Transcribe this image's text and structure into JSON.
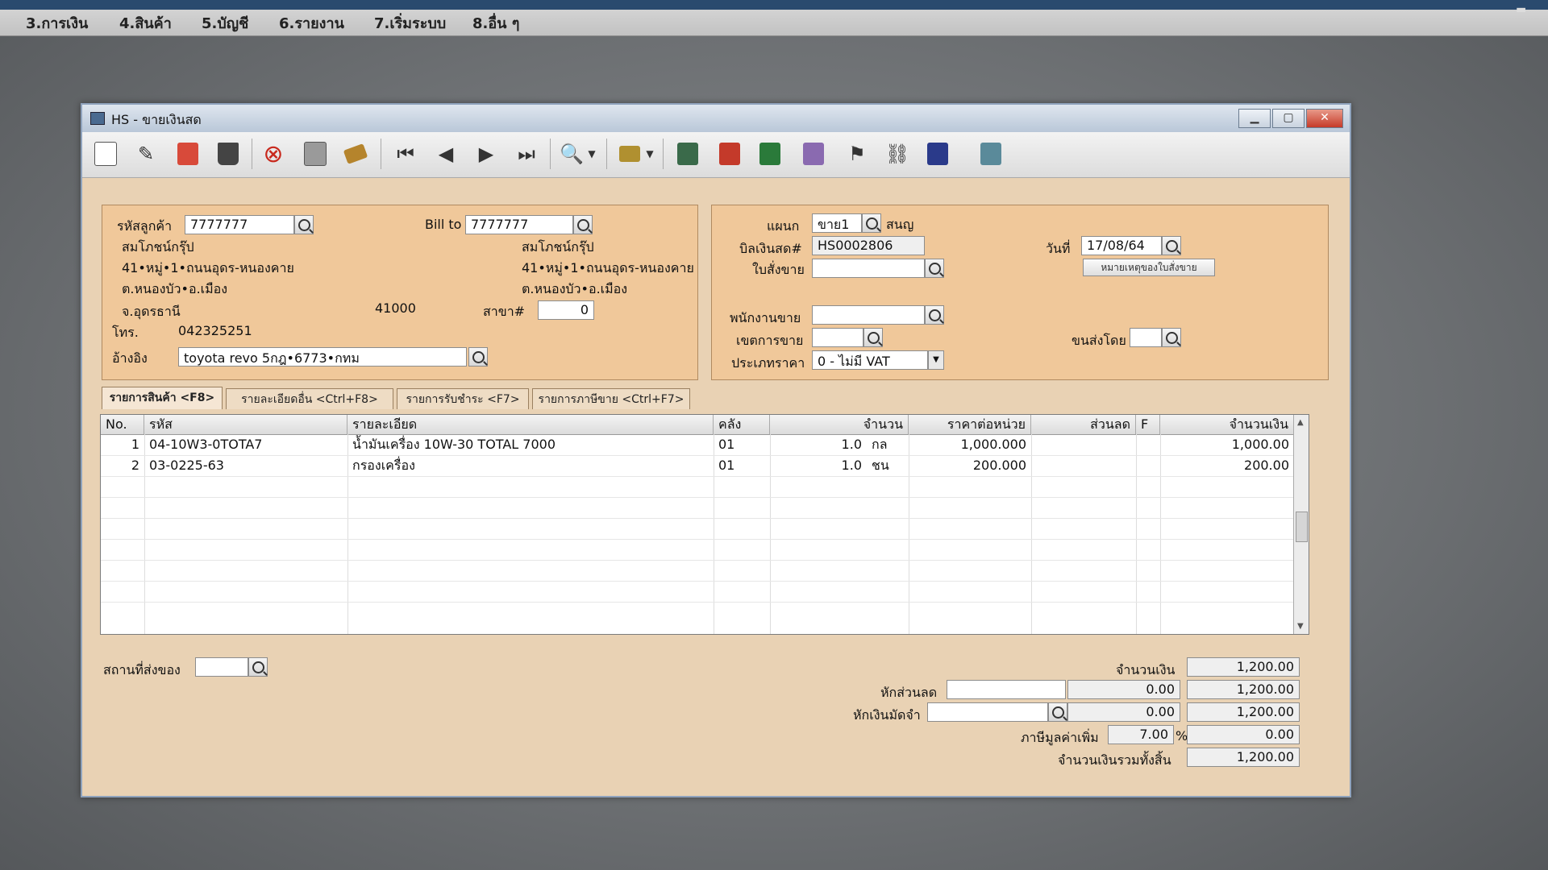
{
  "menu": [
    "3.การเงิน",
    "4.สินค้า",
    "5.บัญชี",
    "6.รายงาน",
    "7.เริ่มระบบ",
    "8.อื่น ๆ"
  ],
  "window": {
    "title": "HS - ขายเงินสด"
  },
  "customer": {
    "code_label": "รหัสลูกค้า",
    "code": "7777777",
    "name": "สมโภชน์กรุ๊ป",
    "addr1": "41•หมู่•1•ถนนอุดร-หนองคาย",
    "addr2": "ต.หนองบัว•อ.เมือง",
    "addr3": "จ.อุดรธานี",
    "zip": "41000",
    "tel_label": "โทร.",
    "tel": "042325251",
    "ref_label": "อ้างอิง",
    "ref": "toyota revo 5กฎ•6773•กทม"
  },
  "billto": {
    "label": "Bill to",
    "code": "7777777",
    "name": "สมโภชน์กรุ๊ป",
    "addr1": "41•หมู่•1•ถนนอุดร-หนองคาย",
    "addr2": "ต.หนองบัว•อ.เมือง",
    "branch_label": "สาขา#",
    "branch": "0"
  },
  "doc": {
    "dept_label": "แผนก",
    "dept": "ขาย1",
    "dept_name": "สนญ",
    "bill_label": "บิลเงินสด#",
    "bill": "HS0002806",
    "date_label": "วันที่",
    "date": "17/08/64",
    "order_label": "ใบสั่งขาย",
    "order": "",
    "note_button": "หมายเหตุของใบสั่งขาย",
    "salesman_label": "พนักงานขาย",
    "salesman": "",
    "area_label": "เขตการขาย",
    "area": "",
    "ship_label": "ขนส่งโดย",
    "ship": "",
    "price_label": "ประเภทราคา",
    "price_type": "0 - ไม่มี VAT"
  },
  "tabs": [
    "รายการสินค้า <F8>",
    "รายละเอียดอื่น <Ctrl+F8>",
    "รายการรับชำระ <F7>",
    "รายการภาษีขาย <Ctrl+F7>"
  ],
  "grid": {
    "headers": [
      "No.",
      "รหัส",
      "รายละเอียด",
      "คลัง",
      "จำนวน",
      "ราคาต่อหน่วย",
      "ส่วนลด",
      "F",
      "จำนวนเงิน"
    ],
    "rows": [
      {
        "no": "1",
        "code": "04-10W3-0TOTA7",
        "desc": "น้ำมันเครื่อง 10W-30 TOTAL 7000",
        "wh": "01",
        "qty": "1.0",
        "unit": "กล",
        "price": "1,000.000",
        "disc": "",
        "f": "",
        "amount": "1,000.00"
      },
      {
        "no": "2",
        "code": "03-0225-63",
        "desc": "กรองเครื่อง",
        "wh": "01",
        "qty": "1.0",
        "unit": "ชน",
        "price": "200.000",
        "disc": "",
        "f": "",
        "amount": "200.00"
      }
    ]
  },
  "footer": {
    "delivery_label": "สถานที่ส่งของ",
    "delivery": "",
    "amount_label": "จำนวนเงิน",
    "amount": "1,200.00",
    "discount_label": "หักส่วนลด",
    "discount_text": "",
    "discount": "0.00",
    "after_discount": "1,200.00",
    "deposit_label": "หักเงินมัดจำ",
    "deposit_text": "",
    "deposit": "0.00",
    "after_deposit": "1,200.00",
    "vat_label": "ภาษีมูลค่าเพิ่ม",
    "vat_rate": "7.00",
    "vat_pct": "%",
    "vat": "0.00",
    "total_label": "จำนวนเงินรวมทั้งสิ้น",
    "total": "1,200.00"
  }
}
